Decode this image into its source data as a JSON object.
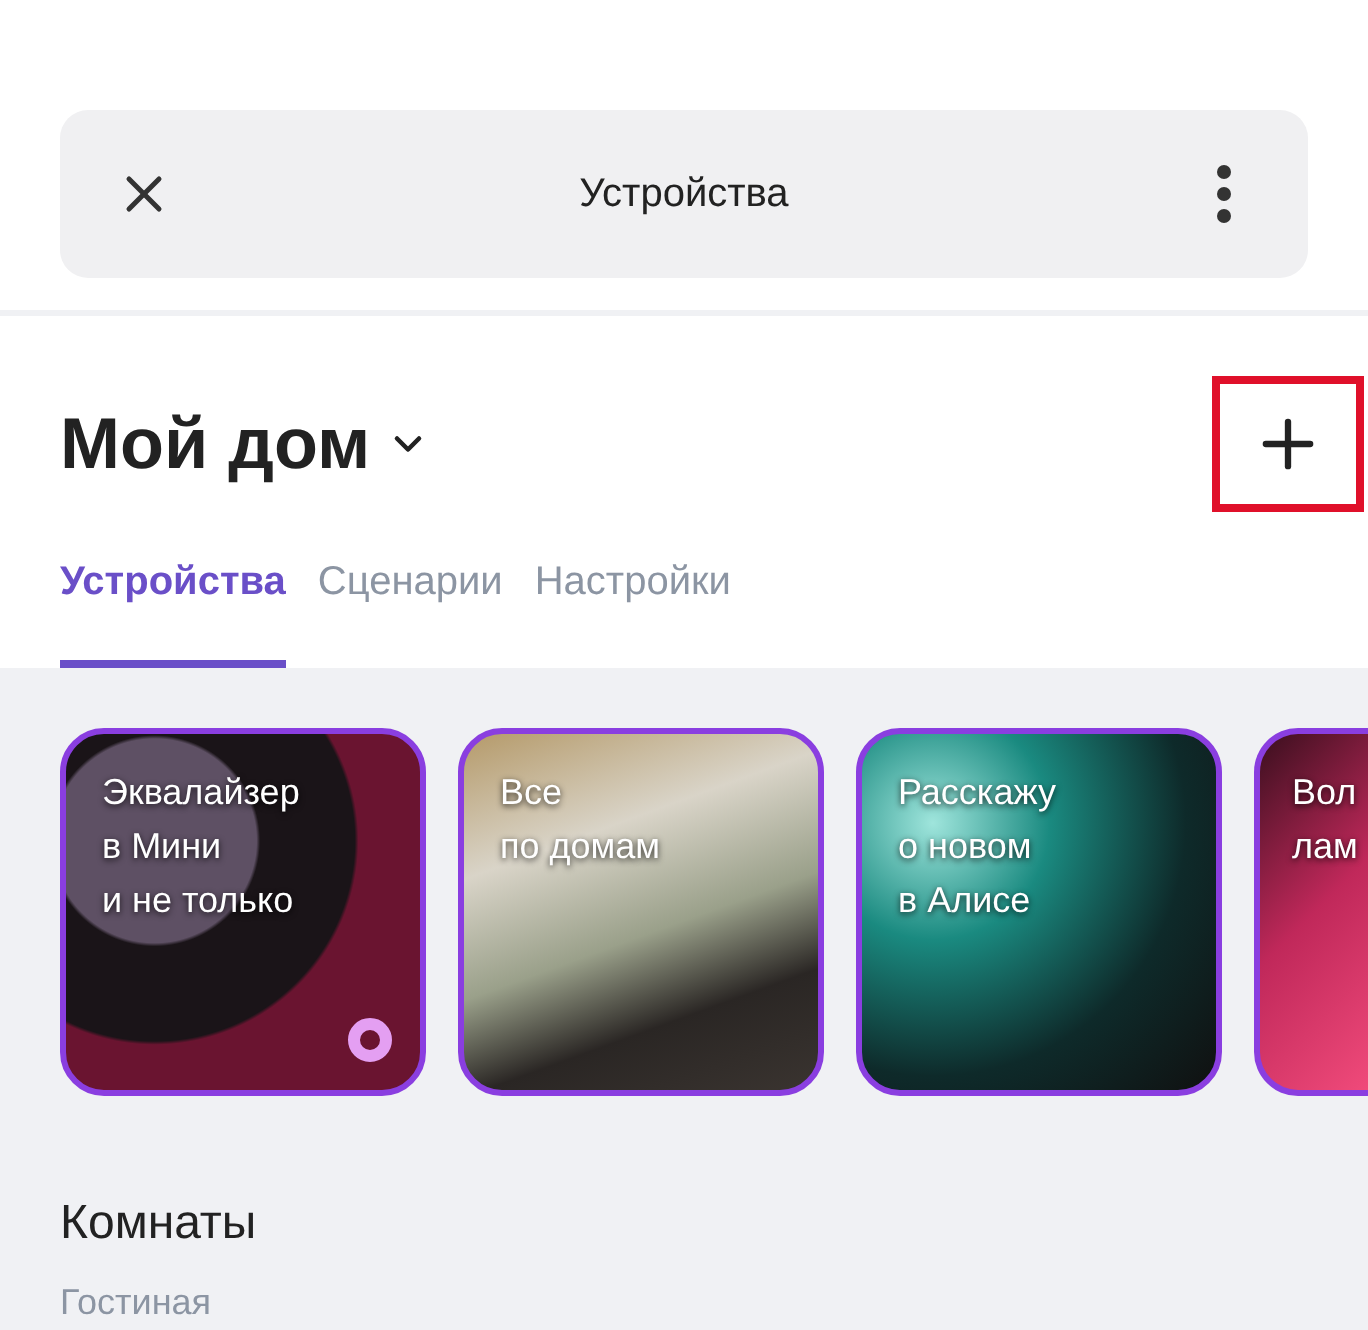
{
  "top_bar": {
    "title": "Устройства"
  },
  "header": {
    "title": "Мой дом",
    "add_button": {
      "highlighted": true
    }
  },
  "tabs": [
    {
      "label": "Устройства",
      "selected": true
    },
    {
      "label": "Сценарии",
      "selected": false
    },
    {
      "label": "Настройки",
      "selected": false
    }
  ],
  "stories": [
    {
      "lines": [
        "Эквалайзер",
        "в Мини",
        "и не только"
      ],
      "kind": "speakers",
      "badge": true
    },
    {
      "lines": [
        "Все",
        "по домам"
      ],
      "kind": "room",
      "badge": false
    },
    {
      "lines": [
        "Расскажу",
        "о новом",
        "в Алисе"
      ],
      "kind": "stage",
      "badge": false
    },
    {
      "lines": [
        "Вол",
        "лам"
      ],
      "kind": "lamp",
      "badge": false
    }
  ],
  "rooms": {
    "title": "Комнаты",
    "first_room": "Гостиная"
  }
}
